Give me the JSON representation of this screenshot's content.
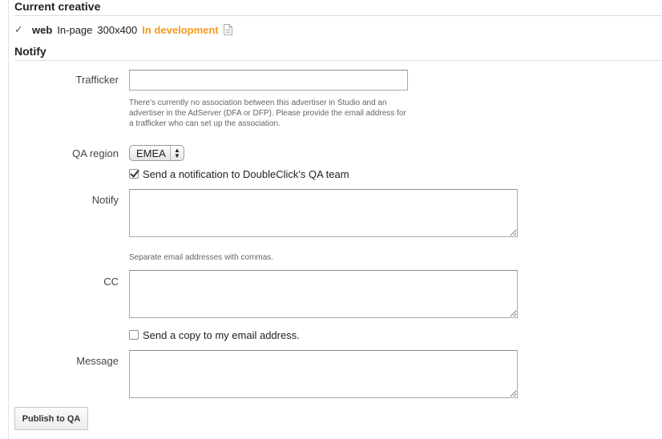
{
  "current_creative": {
    "heading": "Current creative",
    "name": "web",
    "type": "In-page",
    "size": "300x400",
    "status": "In development",
    "status_color": "#f39b1c"
  },
  "notify_section": {
    "heading": "Notify",
    "trafficker": {
      "label": "Trafficker",
      "value": "",
      "help": "There's currently no association between this advertiser in Studio and an advertiser in the AdServer (DFA or DFP). Please provide the email address for a trafficker who can set up the association."
    },
    "qa_region": {
      "label": "QA region",
      "selected": "EMEA"
    },
    "notify_qa_team": {
      "label": "Send a notification to DoubleClick's QA team",
      "checked": true
    },
    "notify": {
      "label": "Notify",
      "value": "",
      "help": "Separate email addresses with commas."
    },
    "cc": {
      "label": "CC",
      "value": ""
    },
    "send_copy": {
      "label": "Send a copy to my email address.",
      "checked": false
    },
    "message": {
      "label": "Message",
      "value": ""
    }
  },
  "actions": {
    "publish_label": "Publish to QA"
  }
}
